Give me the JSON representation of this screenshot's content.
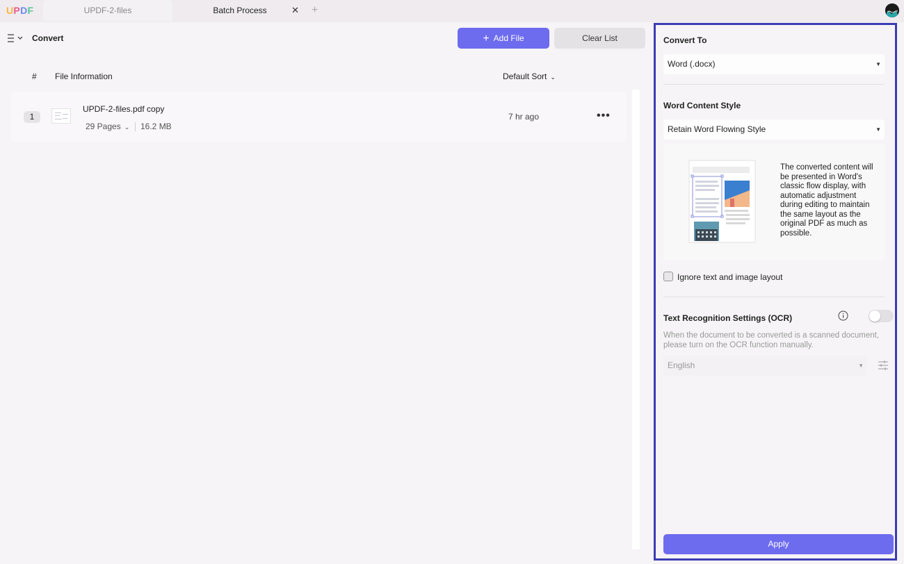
{
  "app": {
    "logo": "UPDF",
    "tabs": [
      {
        "label": "UPDF-2-files"
      },
      {
        "label": "Batch Process",
        "close": "✕"
      }
    ],
    "new_tab": "+"
  },
  "toolbar": {
    "title": "Convert",
    "add_file": "Add File",
    "clear_list": "Clear List"
  },
  "list": {
    "header_index": "#",
    "header_info": "File Information",
    "sort": "Default Sort",
    "files": [
      {
        "index": "1",
        "name": "UPDF-2-files.pdf copy",
        "pages": "29 Pages",
        "size": "16.2 MB",
        "time": "7 hr ago",
        "more": "•••"
      }
    ]
  },
  "panel": {
    "convert_to_label": "Convert To",
    "convert_to_value": "Word (.docx)",
    "style_label": "Word Content Style",
    "style_value": "Retain Word Flowing Style",
    "style_description": "The converted content will be presented in Word's classic flow display, with automatic adjustment during editing to maintain the same layout as the original PDF as much as possible.",
    "ignore_layout_label": "Ignore text and image layout",
    "ignore_layout_checked": false,
    "ocr_label": "Text Recognition Settings (OCR)",
    "ocr_enabled": false,
    "ocr_hint": "When the document to be converted is a scanned document, please turn on the OCR function manually.",
    "ocr_language": "English",
    "apply": "Apply"
  },
  "colors": {
    "accent": "#6d6bee",
    "panel_border": "#3c3cb4"
  }
}
